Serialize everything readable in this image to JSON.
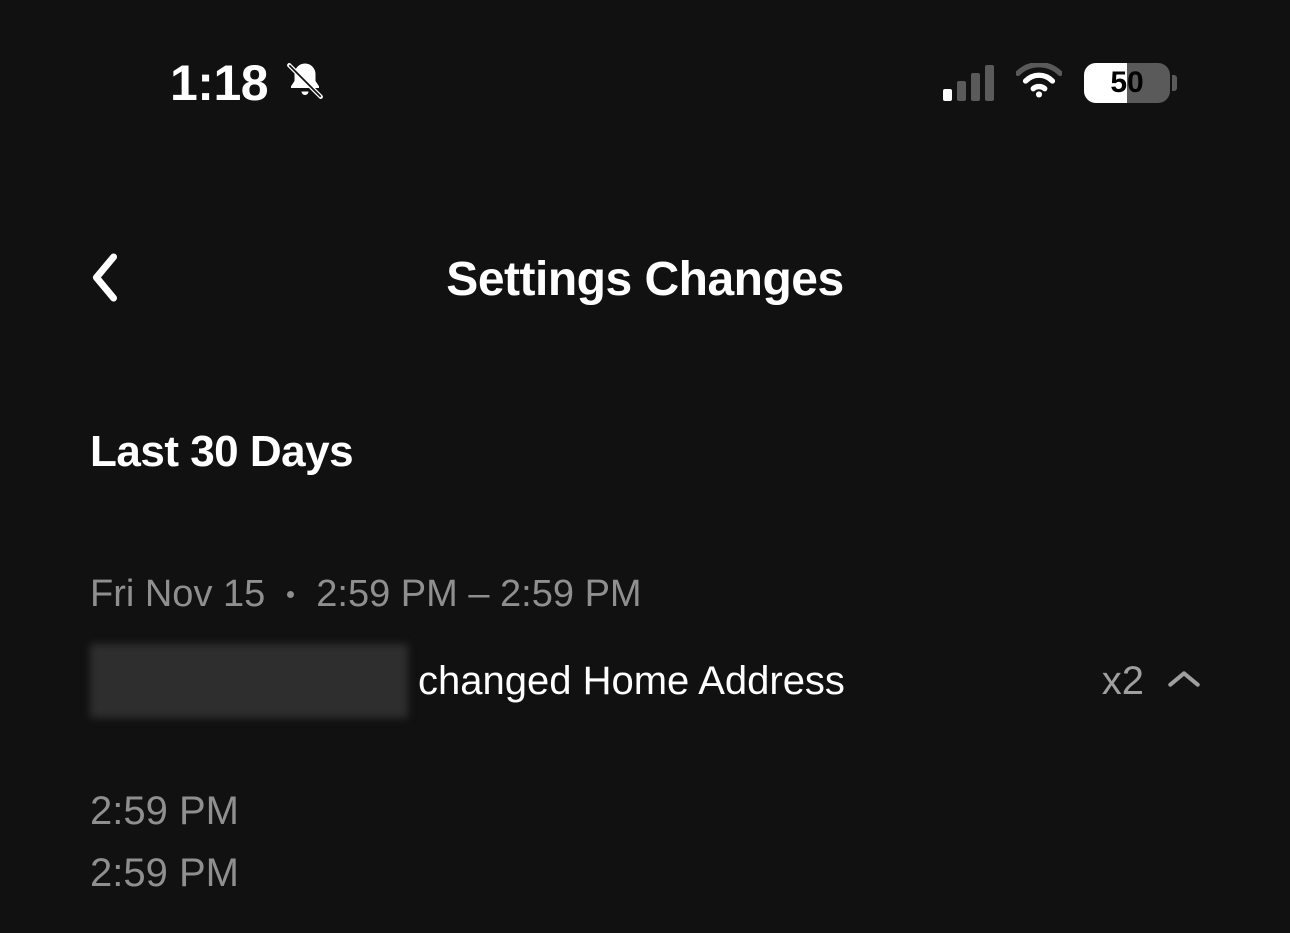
{
  "status_bar": {
    "time": "1:18",
    "battery_pct": "50",
    "icons": {
      "dnd": "bell-slash-icon",
      "cellular": "cellular-icon",
      "wifi": "wifi-icon",
      "battery": "battery-icon"
    }
  },
  "nav": {
    "back_icon": "chevron-left-icon",
    "title": "Settings Changes"
  },
  "section": {
    "heading": "Last 30 Days"
  },
  "events": [
    {
      "date_label": "Fri Nov 15",
      "time_range": "2:59 PM – 2:59 PM",
      "action_text": "changed Home Address",
      "count_label": "x2",
      "expand_icon": "chevron-up-icon",
      "expanded_times": [
        "2:59 PM",
        "2:59 PM"
      ]
    }
  ]
}
